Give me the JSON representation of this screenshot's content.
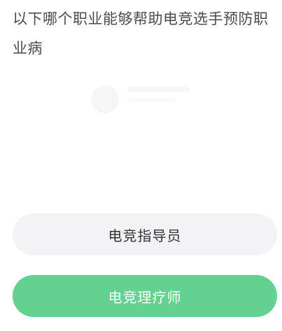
{
  "question": {
    "text": "以下哪个职业能够帮助电竞选手预防职业病"
  },
  "options": [
    {
      "label": "电竞指导员",
      "state": "default",
      "background": "#f3f3f5"
    },
    {
      "label": "电竞理疗师",
      "state": "selected",
      "background": "#63d18f"
    }
  ],
  "colors": {
    "accent": "#63d18f",
    "question_text": "#4a4a4a",
    "option_text": "#333333"
  }
}
